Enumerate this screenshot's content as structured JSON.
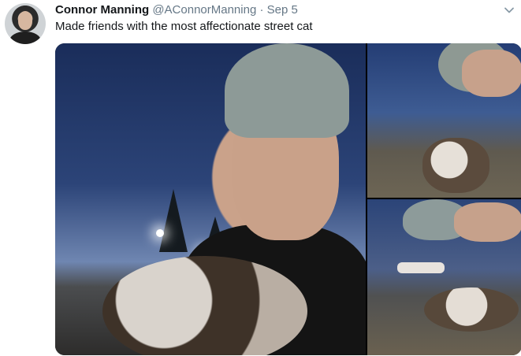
{
  "tweet": {
    "display_name": "Connor Manning",
    "handle": "@AConnorManning",
    "separator": "·",
    "date": "Sep 5",
    "text": "Made friends with the most affectionate street cat"
  },
  "icons": {
    "avatar": "avatar",
    "more_menu": "chevron-down-icon"
  },
  "media": {
    "photos": [
      "selfie-with-cat",
      "cat-close-up-1",
      "cat-close-up-2"
    ]
  }
}
